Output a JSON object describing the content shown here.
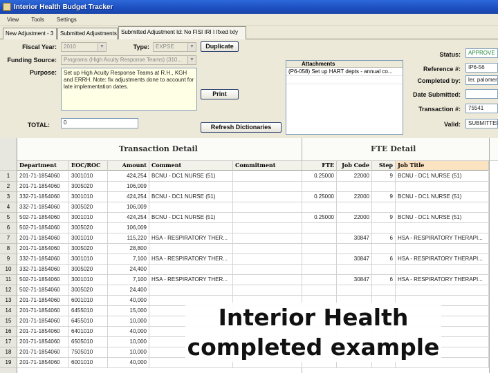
{
  "window": {
    "title": "Interior Health Budget Tracker"
  },
  "menu": [
    "View",
    "Tools",
    "Settings"
  ],
  "tabs": [
    "New Adjustment - 3",
    "Submitted Adjustments",
    "Submitted Adjustment Id: No FISI IRI I Ifxed Ixly"
  ],
  "form": {
    "fiscal_year_label": "Fiscal Year:",
    "fiscal_year_value": "2010",
    "type_label": "Type:",
    "type_value": "EXPSE",
    "duplicate_label": "Duplicate",
    "funding_source_label": "Funding Source:",
    "funding_source_value": "Programs (High Acuity Response Teams) (310...",
    "purpose_label": "Purpose:",
    "purpose_value": "Set up High Acuity Response Teams at R.H., KGH and ERRH. Note: fix adjustments done to account for late implementation dates.",
    "print_label": "Print",
    "total_label": "TOTAL:",
    "total_value": "0",
    "refresh_label": "Refresh Dictionaries",
    "attachments_header": "Attachments",
    "attachments": [
      "(P6-058) Set up HART depts - annual co..."
    ],
    "status_label": "Status:",
    "status_value": "APPROVE",
    "reference_label": "Reference #:",
    "reference_value": "IP6-56",
    "completed_by_label": "Completed by:",
    "completed_by_value": "ler, palomer",
    "date_submitted_label": "Date Submitted:",
    "date_submitted_value": "",
    "transaction_label": "Transaction #:",
    "transaction_value": "75541",
    "valid_label": "Valid:",
    "valid_value": "SUBMITTED"
  },
  "sheet": {
    "transaction_title": "Transaction Detail",
    "fte_title": "FTE Detail",
    "columns": [
      "Department",
      "EOC/ROC",
      "Amount",
      "Comment",
      "Commitment",
      "FTE",
      "Job Code",
      "Step",
      "Job Title"
    ],
    "rows": [
      [
        "1",
        "201-71-1854060",
        "3001010",
        "424,254",
        "BCNU - DC1 NURSE (51)",
        "",
        "0.25000",
        "22000",
        "9",
        "BCNU - DC1 NURSE (51)"
      ],
      [
        "2",
        "201-71-1854060",
        "3005020",
        "106,009",
        "",
        "",
        "",
        "",
        "",
        ""
      ],
      [
        "3",
        "332-71-1854060",
        "3001010",
        "424,254",
        "BCNU - DC1 NURSE (51)",
        "",
        "0.25000",
        "22000",
        "9",
        "BCNU - DC1 NURSE (51)"
      ],
      [
        "4",
        "332-71-1854060",
        "3005020",
        "106,009",
        "",
        "",
        "",
        "",
        "",
        ""
      ],
      [
        "5",
        "502-71-1854060",
        "3001010",
        "424,254",
        "BCNU - DC1 NURSE (51)",
        "",
        "0.25000",
        "22000",
        "9",
        "BCNU - DC1 NURSE (51)"
      ],
      [
        "6",
        "502-71-1854060",
        "3005020",
        "106,009",
        "",
        "",
        "",
        "",
        "",
        ""
      ],
      [
        "7",
        "201-71-1854060",
        "3001010",
        "115,220",
        "HSA - RESPIRATORY THER...",
        "",
        "",
        "30847",
        "6",
        "HSA - RESPIRATORY THERAPI..."
      ],
      [
        "8",
        "201-71-1854060",
        "3005020",
        "28,800",
        "",
        "",
        "",
        "",
        "",
        ""
      ],
      [
        "9",
        "332-71-1854060",
        "3001010",
        "7,100",
        "HSA - RESPIRATORY THER...",
        "",
        "",
        "30847",
        "6",
        "HSA - RESPIRATORY THERAPI..."
      ],
      [
        "10",
        "332-71-1854060",
        "3005020",
        "24,400",
        "",
        "",
        "",
        "",
        "",
        ""
      ],
      [
        "11",
        "502-71-1854060",
        "3001010",
        "7,100",
        "HSA - RESPIRATORY THER...",
        "",
        "",
        "30847",
        "6",
        "HSA - RESPIRATORY THERAPI..."
      ],
      [
        "12",
        "502-71-1854060",
        "3005020",
        "24,400",
        "",
        "",
        "",
        "",
        "",
        ""
      ],
      [
        "13",
        "201-71-1854060",
        "6001010",
        "40,000",
        "",
        "",
        "",
        "",
        "",
        ""
      ],
      [
        "14",
        "201-71-1854060",
        "6455010",
        "15,000",
        "",
        "",
        "",
        "",
        "",
        ""
      ],
      [
        "15",
        "201-71-1854060",
        "6455010",
        "10,000",
        "",
        "",
        "",
        "",
        "",
        ""
      ],
      [
        "16",
        "201-71-1854060",
        "6401010",
        "40,000",
        "",
        "",
        "",
        "",
        "",
        ""
      ],
      [
        "17",
        "201-71-1854060",
        "6505010",
        "10,000",
        "",
        "",
        "",
        "",
        "",
        ""
      ],
      [
        "18",
        "201-71-1854060",
        "7505010",
        "10,000",
        "",
        "",
        "",
        "",
        "",
        ""
      ],
      [
        "19",
        "201-71-1854060",
        "6001010",
        "40,000",
        "",
        "",
        "",
        "",
        "",
        ""
      ]
    ]
  },
  "overlay": {
    "line1": "Interior Health",
    "line2": "completed example"
  }
}
